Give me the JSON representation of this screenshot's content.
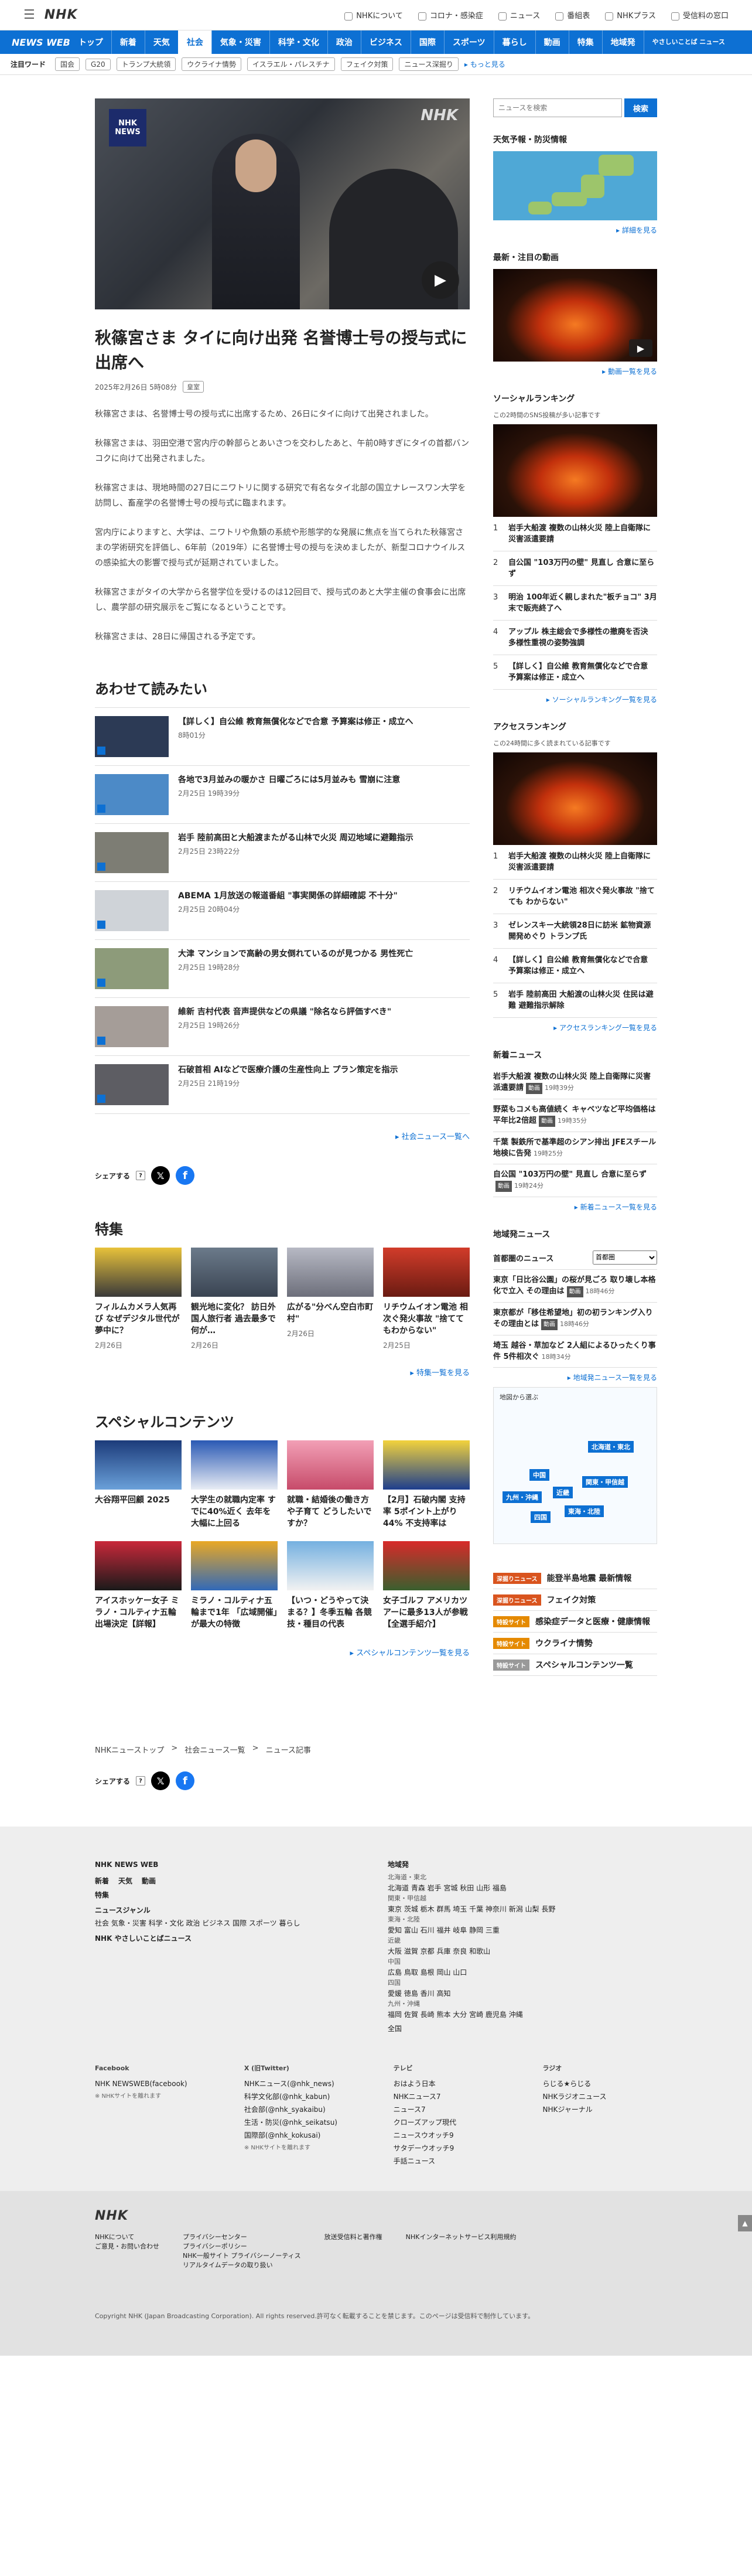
{
  "top": {
    "logo": "NHK",
    "links": [
      "NHKについて",
      "コロナ・感染症",
      "ニュース",
      "番組表",
      "NHKプラス",
      "受信料の窓口"
    ]
  },
  "nav": {
    "logo": "NEWS WEB",
    "items": [
      "トップ",
      "新着",
      "天気",
      "社会",
      "気象・災害",
      "科学・文化",
      "政治",
      "ビジネス",
      "国際",
      "スポーツ",
      "暮らし",
      "動画",
      "特集",
      "地域発"
    ],
    "easy": "やさしいことば ニュース"
  },
  "trending": {
    "label": "注目ワード",
    "tags": [
      "国会",
      "G20",
      "トランプ大統領",
      "ウクライナ情勢",
      "イスラエル・パレスチナ",
      "フェイク対策",
      "ニュース深掘り"
    ],
    "more": "もっと見る"
  },
  "hero": {
    "badge_top": "NHK",
    "badge_bottom": "NEWS",
    "watermark": "NHK"
  },
  "article": {
    "title": "秋篠宮さま タイに向け出発 名誉博士号の授与式に出席へ",
    "date": "2025年2月26日 5時08分",
    "category": "皇室",
    "paragraphs": [
      "秋篠宮さまは、名誉博士号の授与式に出席するため、26日にタイに向けて出発されました。",
      "秋篠宮さまは、羽田空港で宮内庁の幹部らとあいさつを交わしたあと、午前0時すぎにタイの首都バンコクに向けて出発されました。",
      "秋篠宮さまは、現地時間の27日にニワトリに関する研究で有名なタイ北部の国立ナレースワン大学を訪問し、畜産学の名誉博士号の授与式に臨まれます。",
      "宮内庁によりますと、大学は、ニワトリや魚類の系統や形態学的な発展に焦点を当てられた秋篠宮さまの学術研究を評価し、6年前（2019年）に名誉博士号の授与を決めましたが、新型コロナウイルスの感染拡大の影響で授与式が延期されていました。",
      "秋篠宮さまがタイの大学から名誉学位を受けるのは12回目で、授与式のあと大学主催の食事会に出席し、農学部の研究展示をご覧になるということです。",
      "秋篠宮さまは、28日に帰国される予定です。"
    ]
  },
  "related": {
    "title": "あわせて読みたい",
    "items": [
      {
        "title": "【詳しく】自公維 教育無償化などで合意 予算案は修正・成立へ",
        "date": "8時01分"
      },
      {
        "title": "各地で3月並みの暖かさ 日曜ごろには5月並みも 雪崩に注意",
        "date": "2月25日 19時39分"
      },
      {
        "title": "岩手 陸前高田と大船渡またがる山林で火災 周辺地域に避難指示",
        "date": "2月25日 23時22分"
      },
      {
        "title": "ABEMA 1月放送の報道番組 \"事実関係の詳細確認 不十分\"",
        "date": "2月25日 20時04分"
      },
      {
        "title": "大津 マンションで高齢の男女倒れているのが見つかる 男性死亡",
        "date": "2月25日 19時28分"
      },
      {
        "title": "維新 吉村代表 音声提供などの県議 \"除名なら評価すべき\"",
        "date": "2月25日 19時26分"
      },
      {
        "title": "石破首相 AIなどで医療介護の生産性向上 プラン策定を指示",
        "date": "2月25日 21時19分"
      }
    ],
    "more": "社会ニュース一覧へ"
  },
  "share": {
    "label": "シェアする",
    "q": "?"
  },
  "features": {
    "title": "特集",
    "items": [
      {
        "title": "フィルムカメラ人気再び なぜデジタル世代が夢中に？",
        "date": "2月26日"
      },
      {
        "title": "観光地に変化？ 訪日外国人旅行者 過去最多で何が…",
        "date": "2月26日"
      },
      {
        "title": "広がる\"分べん空白市町村\"",
        "date": "2月26日"
      },
      {
        "title": "リチウムイオン電池 相次ぐ発火事故 \"捨ててもわからない\"",
        "date": "2月25日"
      }
    ],
    "more": "特集一覧を見る"
  },
  "special": {
    "title": "スペシャルコンテンツ",
    "items": [
      {
        "title": "大谷翔平回顧 2025"
      },
      {
        "title": "大学生の就職内定率 すでに40%近く 去年を大幅に上回る"
      },
      {
        "title": "就職・結婚後の働き方や子育て どうしたいですか？"
      },
      {
        "title": "【2月】石破内閣 支持率 5ポイント上がり44% 不支持率は"
      },
      {
        "title": "アイスホッケー女子 ミラノ・コルティナ五輪出場決定【詳報】"
      },
      {
        "title": "ミラノ・コルティナ五輪まで1年 「広域開催」が最大の特徴"
      },
      {
        "title": "【いつ・どうやって決まる？】冬季五輪 各競技・種目の代表"
      },
      {
        "title": "女子ゴルフ アメリカツアーに最多13人が参戦【全選手紹介】"
      }
    ],
    "more": "スペシャルコンテンツ一覧を見る"
  },
  "sidebar": {
    "search_placeholder": "ニュースを検索",
    "search_btn": "検索",
    "weather": {
      "title": "天気予報・防災情報",
      "more": "詳細を見る"
    },
    "video": {
      "title": "最新・注目の動画",
      "caption": "",
      "more": "動画一覧を見る"
    },
    "social": {
      "title": "ソーシャルランキング",
      "sub": "この2時間のSNS投稿が多い記事です",
      "items": [
        "岩手大船渡 複数の山林火災 陸上自衛隊に災害派遣要請",
        "自公国 \"103万円の壁\" 見直し 合意に至らず",
        "明治 100年近く親しまれた\"板チョコ\"価格 3月末で販売終了へ",
        "アップル 株主総会で"
      ],
      "items_full": [
        "岩手大船渡 複数の山林火災 陸上自衛隊に災害派遣要請",
        "自公国 \"103万円の壁\" 見直し 合意に至らず",
        "明治 100年近く親しまれた\"板チョコ\" 3月末で販売終了へ",
        "アップル 株主総会で多様性の撤廃を否決 多様性重視の姿勢強調",
        "【詳しく】自公維 教育無償化などで合意 予算案は修正・成立へ"
      ],
      "more": "ソーシャルランキング一覧を見る"
    },
    "access": {
      "title": "アクセスランキング",
      "sub": "この24時間に多く読まれている記事です",
      "items": [
        "岩手大船渡 複数の山林火災 陸上自衛隊に災害派遣要請",
        "リチウムイオン電池 相次ぐ発火事故 \"捨てても わからない\"",
        "ゼレンスキー大統領28日に訪米 鉱物資源開発めぐり トランプ氏",
        "【詳しく】自公維 教育無償化などで合意 予算案は修正・成立へ",
        "岩手 陸前高田 大船渡の山林火災 住民は避難 避難指示解除"
      ],
      "more": "アクセスランキング一覧を見る"
    },
    "latest": {
      "title": "新着ニュース",
      "items": [
        {
          "title": "岩手大船渡 複数の山林火災 陸上自衛隊に災害派遣要請",
          "tag": "動画",
          "date": "19時39分"
        },
        {
          "title": "野菜もコメも高値続く キャベツなど平均価格は平年比2倍超",
          "tag": "動画",
          "date": "19時35分"
        },
        {
          "title": "千葉 製鉄所で基準超のシアン排出 JFEスチール 地検に告発",
          "tag": "",
          "date": "19時25分"
        },
        {
          "title": "自公国 \"103万円の壁\" 見直し 合意に至らず",
          "tag": "動画",
          "date": "19時24分"
        }
      ],
      "more": "新着ニュース一覧を見る"
    },
    "local": {
      "title": "地域発ニュース",
      "area_label": "首都圏のニュース",
      "select": "首都圏",
      "items": [
        {
          "title": "東京「日比谷公園」の桜が見ごろ 取り壊し本格化で立入 その理由は",
          "tag": "動画",
          "date": "18時46分"
        },
        {
          "title": "東京都が「移住希望地」初の初ランキング入り その理由とは",
          "tag": "動画",
          "date": "18時46分"
        },
        {
          "title": "埼玉 越谷・草加など 2人組によるひったくり事件 5件相次ぐ",
          "tag": "",
          "date": "18時34分"
        }
      ],
      "more": "地域発ニュース一覧を見る",
      "map_title": "地図から選ぶ",
      "regions": [
        "北海道・東北",
        "関東・甲信越",
        "東海・北陸",
        "近畿",
        "中国",
        "四国",
        "九州・沖縄"
      ]
    },
    "picks": [
      {
        "label": "深掘りニュース",
        "text": "能登半島地震 最新情報"
      },
      {
        "label": "深掘りニュース",
        "text": "フェイク対策"
      },
      {
        "label": "特設サイト",
        "text": "感染症データと医療・健康情報"
      },
      {
        "label": "特設サイト",
        "text": "ウクライナ情勢"
      },
      {
        "label": "特設サイト",
        "text": "スペシャルコンテンツ一覧"
      }
    ]
  },
  "breadcrumb": [
    "NHKニューストップ",
    "社会ニュース一覧",
    "ニュース記事"
  ],
  "footer": {
    "brand": "NHK NEWS WEB",
    "left": {
      "row1": [
        "新着",
        "天気",
        "動画"
      ],
      "row2": [
        "特集"
      ],
      "h_news": "ニュースジャンル",
      "genres": "社会 気象・災害 科学・文化 政治 ビジネス 国際 スポーツ 暮らし",
      "easy": "NHK やさしいことばニュース"
    },
    "region": {
      "title": "地域発",
      "groups": [
        {
          "h": "北海道・東北",
          "v": "北海道 青森 岩手 宮城 秋田 山形 福島"
        },
        {
          "h": "関東・甲信越",
          "v": "東京 茨城 栃木 群馬 埼玉 千葉 神奈川 新潟 山梨 長野"
        },
        {
          "h": "東海・北陸",
          "v": "愛知 富山 石川 福井 岐阜 静岡 三重"
        },
        {
          "h": "近畿",
          "v": "大阪 滋賀 京都 兵庫 奈良 和歌山"
        },
        {
          "h": "中国",
          "v": "広島 鳥取 島根 岡山 山口"
        },
        {
          "h": "四国",
          "v": "愛媛 徳島 香川 高知"
        },
        {
          "h": "九州・沖縄",
          "v": "福岡 佐賀 長崎 熊本 大分 宮崎 鹿児島 沖縄"
        }
      ],
      "all": "全国"
    },
    "social": {
      "fb_h": "Facebook",
      "fb": [
        "NHK NEWSWEB(facebook)"
      ],
      "fb_note": "※ NHKサイトを離れます",
      "x_h": "X (旧Twitter)",
      "x": [
        "NHKニュース(@nhk_news)",
        "科学文化部(@nhk_kabun)",
        "社会部(@nhk_syakaibu)",
        "生活・防災(@nhk_seikatsu)",
        "国際部(@nhk_kokusai)"
      ],
      "x_note": "※ NHKサイトを離れます",
      "tv_h": "テレビ",
      "tv": [
        "おはよう日本",
        "NHKニュース7",
        "ニュース7",
        "クローズアップ現代",
        "ニュースウオッチ9",
        "サタデーウオッチ9",
        "手話ニュース"
      ],
      "radio_h": "ラジオ",
      "radio": [
        "らじる★らじる",
        "NHKラジオニュース",
        "NHKジャーナル"
      ]
    },
    "bottom_logo": "NHK",
    "links": [
      [
        "NHKについて",
        "ご意見・お問い合わせ"
      ],
      [
        "プライバシーセンター",
        "プライバシーポリシー",
        "NHK一般サイト プライバシーノーティス",
        "リアルタイムデータの取り扱い"
      ],
      [
        "放送受信料と著作権"
      ],
      [
        "NHKインターネットサービス利用規約"
      ]
    ],
    "copyright": "Copyright NHK (Japan Broadcasting Corporation). All rights reserved.許可なく転載することを禁じます。このページは受信料で制作しています。"
  },
  "page_top": "▲"
}
